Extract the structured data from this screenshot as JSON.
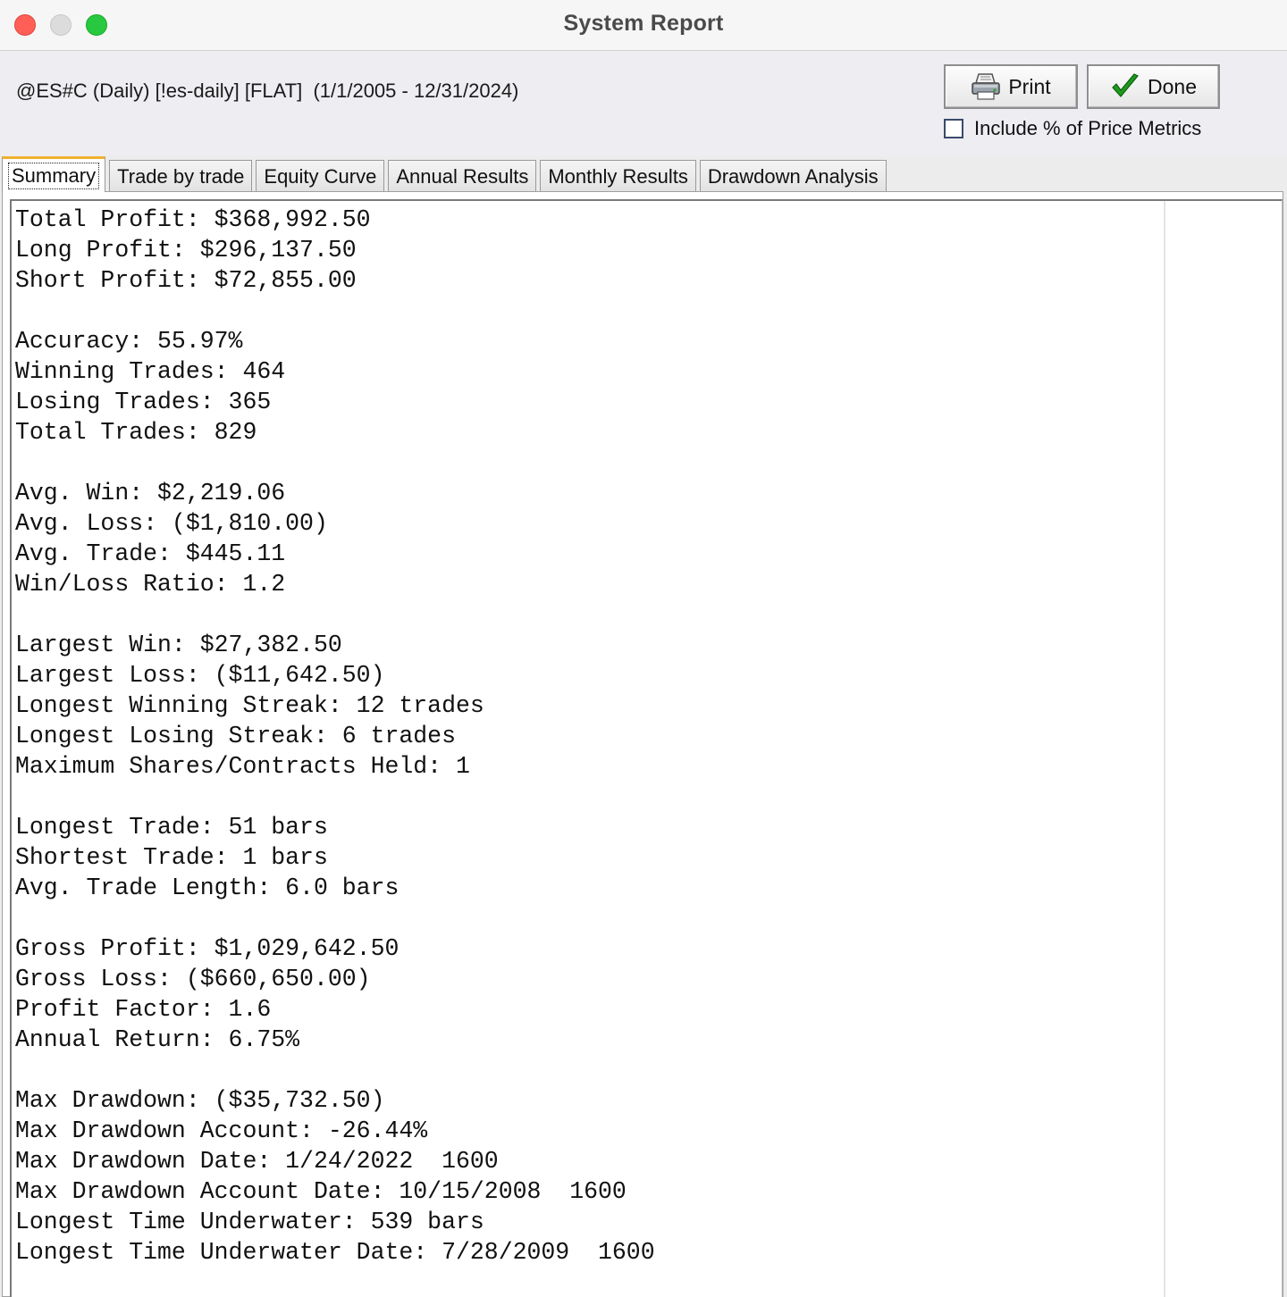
{
  "window": {
    "title": "System Report"
  },
  "header": {
    "subtitle": "@ES#C (Daily) [!es-daily] [FLAT]  (1/1/2005 - 12/31/2024)",
    "print_label": "Print",
    "done_label": "Done",
    "include_metrics_label": "Include % of Price Metrics",
    "include_metrics_checked": false
  },
  "tabs": [
    {
      "label": "Summary",
      "active": true
    },
    {
      "label": "Trade by trade",
      "active": false
    },
    {
      "label": "Equity Curve",
      "active": false
    },
    {
      "label": "Annual Results",
      "active": false
    },
    {
      "label": "Monthly Results",
      "active": false
    },
    {
      "label": "Drawdown Analysis",
      "active": false
    }
  ],
  "report": {
    "lines": [
      "Total Profit: $368,992.50",
      "Long Profit: $296,137.50",
      "Short Profit: $72,855.00",
      "",
      "Accuracy: 55.97%",
      "Winning Trades: 464",
      "Losing Trades: 365",
      "Total Trades: 829",
      "",
      "Avg. Win: $2,219.06",
      "Avg. Loss: ($1,810.00)",
      "Avg. Trade: $445.11",
      "Win/Loss Ratio: 1.2",
      "",
      "Largest Win: $27,382.50",
      "Largest Loss: ($11,642.50)",
      "Longest Winning Streak: 12 trades",
      "Longest Losing Streak: 6 trades",
      "Maximum Shares/Contracts Held: 1",
      "",
      "Longest Trade: 51 bars",
      "Shortest Trade: 1 bars",
      "Avg. Trade Length: 6.0 bars",
      "",
      "Gross Profit: $1,029,642.50",
      "Gross Loss: ($660,650.00)",
      "Profit Factor: 1.6",
      "Annual Return: 6.75%",
      "",
      "Max Drawdown: ($35,732.50)",
      "Max Drawdown Account: -26.44%",
      "Max Drawdown Date: 1/24/2022  1600",
      "Max Drawdown Account Date: 10/15/2008  1600",
      "Longest Time Underwater: 539 bars",
      "Longest Time Underwater Date: 7/28/2009  1600"
    ]
  },
  "colors": {
    "close": "#ff5f57",
    "minimize": "#dcdcdc",
    "zoom": "#28c840",
    "active_tab_accent": "#f0b030",
    "checkmark": "#1e9a1e"
  },
  "icons": {
    "print": "printer-icon",
    "done": "checkmark-icon"
  }
}
